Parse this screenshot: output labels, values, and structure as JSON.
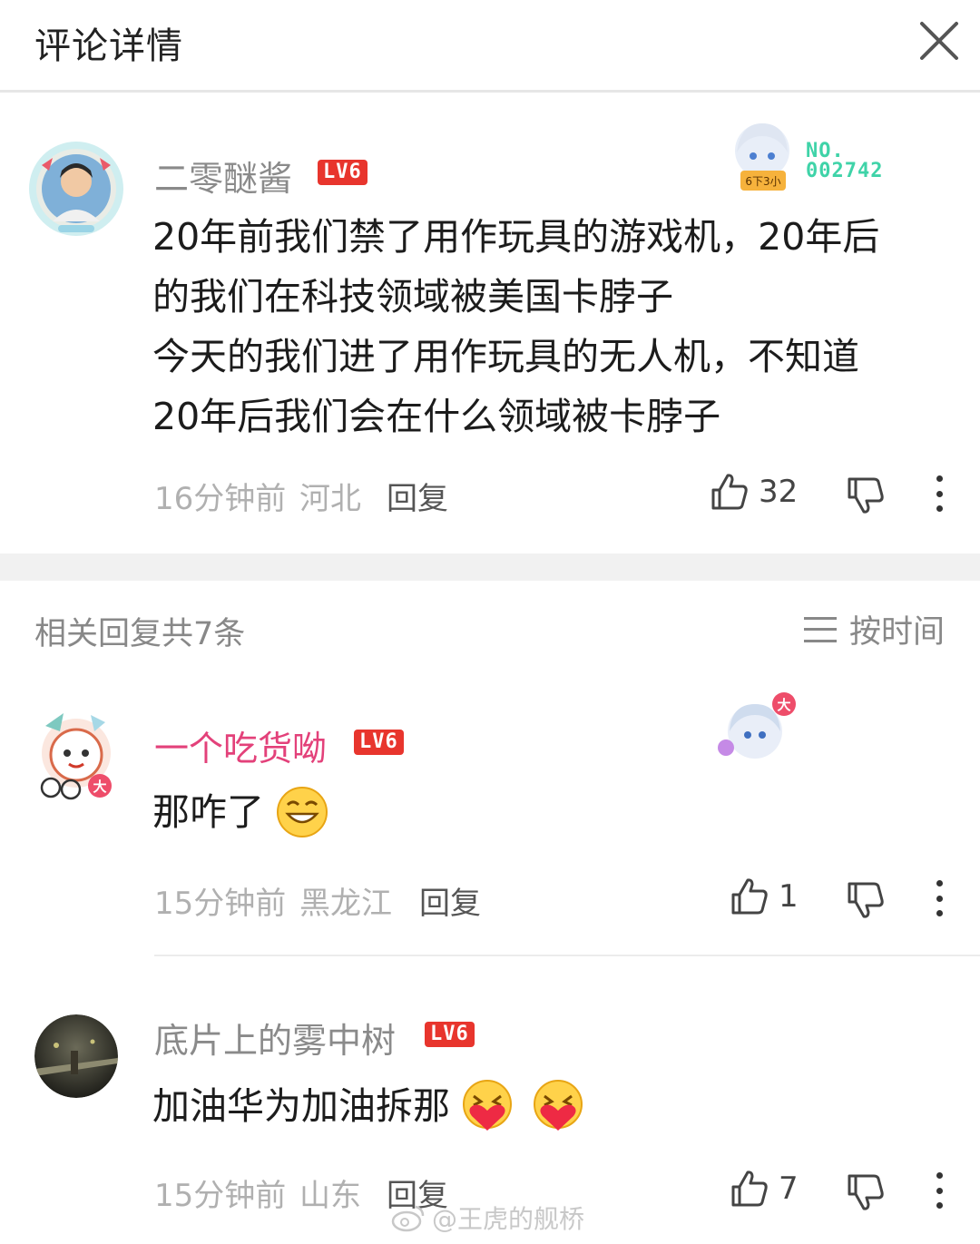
{
  "header": {
    "title": "评论详情"
  },
  "main_comment": {
    "username": "二零醚酱",
    "level": "LV6",
    "badge_text": "NO.\n002742",
    "badge_card_text": "6下3小",
    "lines": [
      "20年前我们禁了用作玩具的游戏机，20年后",
      "的我们在科技领域被美国卡脖子",
      "今天的我们进了用作玩具的无人机，不知道",
      "20年后我们会在什么领域被卡脖子"
    ],
    "time": "16分钟前",
    "location": "河北",
    "reply_label": "回复",
    "likes": "32"
  },
  "replies_header": {
    "count_label": "相关回复共7条",
    "sort_label": "按时间"
  },
  "replies": [
    {
      "username": "一个吃货呦",
      "level": "LV6",
      "text": "那咋了",
      "avatar_badge": "大",
      "time": "15分钟前",
      "location": "黑龙江",
      "reply_label": "回复",
      "likes": "1"
    },
    {
      "username": "底片上的雾中树",
      "level": "LV6",
      "text": "加油华为加油拆那",
      "time": "15分钟前",
      "location": "山东",
      "reply_label": "回复",
      "likes": "7"
    }
  ],
  "watermark": "@王虎的舰桥",
  "colors": {
    "pink_name": "#e3417a",
    "level_badge": "#e8352d",
    "meta_gray": "#b0b0b0"
  }
}
